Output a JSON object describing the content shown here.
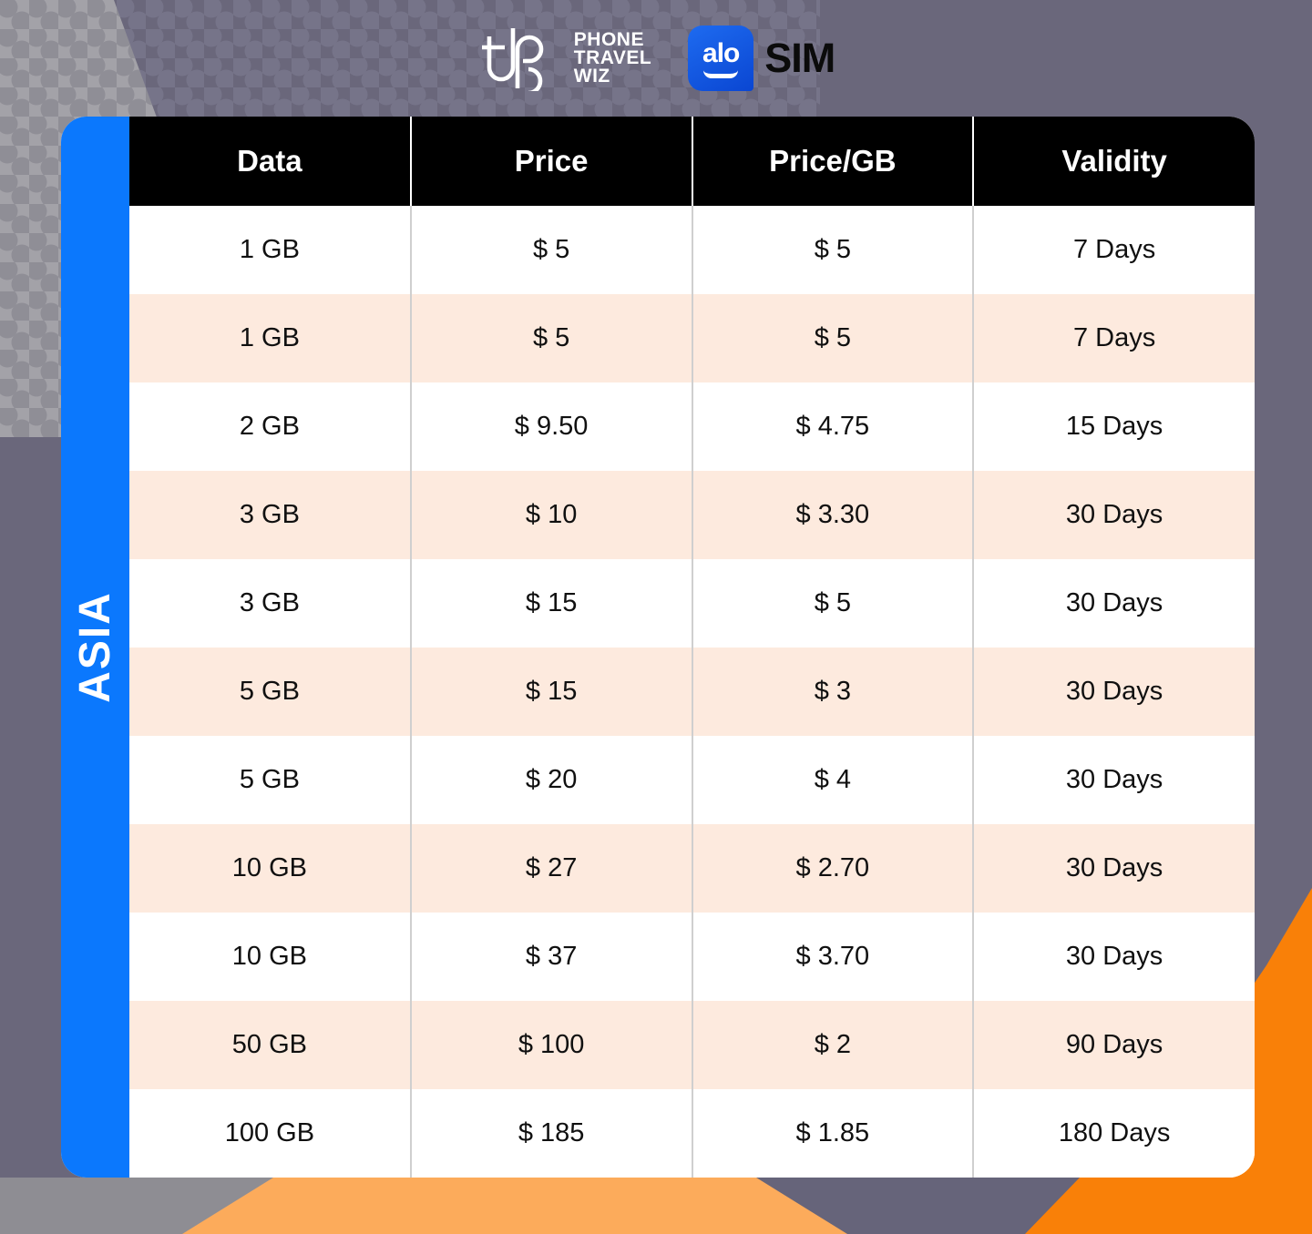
{
  "header": {
    "brand_name_lines": [
      "PHONE",
      "TRAVEL",
      "WIZ"
    ],
    "brand_logo_icon": "phone-travel-wiz-logo-icon",
    "partner_badge_text": "alo",
    "partner_text": "SIM"
  },
  "region": {
    "label": "ASIA",
    "accent_color": "#0b78fd"
  },
  "watermark": {
    "text": "PHONE TRAVEL WIZ",
    "mark_icon": "phone-travel-wiz-mark-icon"
  },
  "table": {
    "columns": [
      "Data",
      "Price",
      "Price/GB",
      "Validity"
    ],
    "header_bg": "#000000",
    "row_alt_bg": "#fdeade",
    "rows": [
      {
        "data": "1 GB",
        "price": "$ 5",
        "price_per_gb": "$ 5",
        "validity": "7 Days"
      },
      {
        "data": "1 GB",
        "price": "$ 5",
        "price_per_gb": "$ 5",
        "validity": "7 Days"
      },
      {
        "data": "2 GB",
        "price": "$ 9.50",
        "price_per_gb": "$ 4.75",
        "validity": "15 Days"
      },
      {
        "data": "3 GB",
        "price": "$ 10",
        "price_per_gb": "$ 3.30",
        "validity": "30 Days"
      },
      {
        "data": "3 GB",
        "price": "$ 15",
        "price_per_gb": "$ 5",
        "validity": "30 Days"
      },
      {
        "data": "5 GB",
        "price": "$ 15",
        "price_per_gb": "$ 3",
        "validity": "30 Days"
      },
      {
        "data": "5 GB",
        "price": "$ 20",
        "price_per_gb": "$ 4",
        "validity": "30 Days"
      },
      {
        "data": "10 GB",
        "price": "$ 27",
        "price_per_gb": "$ 2.70",
        "validity": "30 Days"
      },
      {
        "data": "10 GB",
        "price": "$ 37",
        "price_per_gb": "$ 3.70",
        "validity": "30 Days"
      },
      {
        "data": "50 GB",
        "price": "$ 100",
        "price_per_gb": "$ 2",
        "validity": "90 Days"
      },
      {
        "data": "100 GB",
        "price": "$ 185",
        "price_per_gb": "$ 1.85",
        "validity": "180 Days"
      }
    ]
  },
  "background": {
    "base_color": "#6a677b",
    "dot_panel_light": "#a3a2a8",
    "dot_panel_dark": "#6a677b",
    "orange_primary": "#f98008",
    "orange_light": "#fcab5b",
    "gray_band": "#8e8d93"
  }
}
